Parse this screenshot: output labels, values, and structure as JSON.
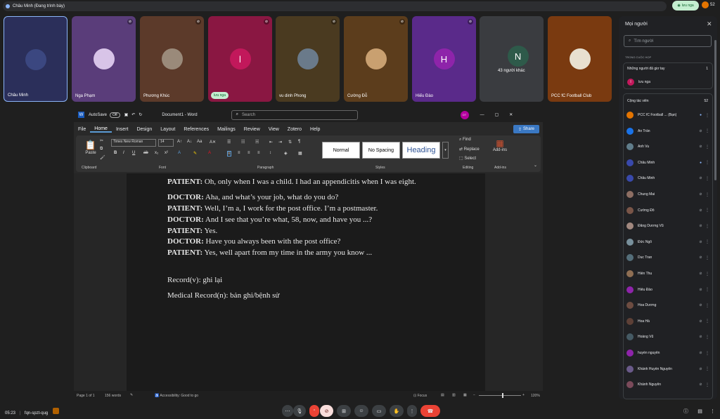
{
  "topbar": {
    "presenter_text": "Châu Minh (Đang trình bày)",
    "present_pill": "lưu nga",
    "people_count": "52"
  },
  "tiles": [
    {
      "name": "Châu Minh",
      "color": "#2b2f5a",
      "avatar": "",
      "muted": false
    },
    {
      "name": "Nga Phạm",
      "color": "#5a3d7a",
      "avatar": "",
      "muted": true
    },
    {
      "name": "Phương Khúc",
      "color": "#5c3a2a",
      "avatar": "",
      "muted": true
    },
    {
      "name": "lưu nga",
      "color": "#8a1742",
      "avatar": "l",
      "muted": true,
      "pill": true
    },
    {
      "name": "vu dinh Phong",
      "color": "#4a3a20",
      "avatar": "",
      "muted": true
    },
    {
      "name": "Cường Đỗ",
      "color": "#5c3d1c",
      "avatar": "",
      "muted": true
    },
    {
      "name": "Hiếu Đào",
      "color": "#5a2a8a",
      "avatar": "H",
      "muted": true
    },
    {
      "name": "43 người khác",
      "color": "#3a3c40",
      "avatar": "N",
      "muted": false,
      "others": true
    },
    {
      "name": "PCC fC Football Club",
      "color": "#7a3a10",
      "avatar": "",
      "muted": false
    }
  ],
  "word": {
    "autosave": "AutoSave",
    "autosave_state": "Off",
    "doc_title": "Document1 - Word",
    "search_placeholder": "Search",
    "user_initials": "DT",
    "menu": [
      "File",
      "Home",
      "Insert",
      "Design",
      "Layout",
      "References",
      "Mailings",
      "Review",
      "View",
      "Zotero",
      "Help"
    ],
    "share": "Share",
    "font_name": "Times New Roman",
    "font_size": "14",
    "styles": [
      "Normal",
      "No Spacing",
      "Heading"
    ],
    "editing": [
      "Find",
      "Replace",
      "Select"
    ],
    "addins": "Add-ins",
    "groups": [
      "Clipboard",
      "Font",
      "Paragraph",
      "Styles",
      "Editing",
      "Add-ins"
    ],
    "paste": "Paste",
    "lines": [
      {
        "speaker": "PATIENT:",
        "text": " Oh, only when I was a child. I had an appendicitis when I was eight."
      },
      {
        "speaker": "DOCTOR:",
        "text": " Aha, and what’s your job, what do you do?"
      },
      {
        "speaker": "PATIENT:",
        "text": " Well, I’m a, I work for the post office. I’m a postmaster."
      },
      {
        "speaker": "DOCTOR:",
        "text": " And I see that you’re what, 58, now, and have you ...?"
      },
      {
        "speaker": "PATIENT:",
        "text": " Yes."
      },
      {
        "speaker": "DOCTOR:",
        "text": " Have you always been with the post office?"
      },
      {
        "speaker": "PATIENT:",
        "text": " Yes, well apart from my time in the army you know ..."
      }
    ],
    "notes": [
      "Record(v): ghi lại",
      "Medical Record(n): bản ghi/bệnh sử"
    ],
    "status": {
      "page": "Page 1 of 1",
      "words": "156 words",
      "accessibility": "Accessibility: Good to go",
      "focus": "Focus",
      "zoom": "120%"
    }
  },
  "panel": {
    "title": "Mọi người",
    "search_placeholder": "Tìm người",
    "in_meeting": "TRONG CUỘC HỌP",
    "raised_hands": "Những người đã giơ tay",
    "raised_count": "1",
    "raised_person": "lưu nga",
    "contributors": "Cộng tác viên",
    "contributors_count": "52",
    "people": [
      {
        "name": "PCC fC Football ... (Bạn)",
        "color": "#e37400"
      },
      {
        "name": "An Trần",
        "color": "#1a73e8"
      },
      {
        "name": "Anh Vu",
        "color": "#607d8b"
      },
      {
        "name": "Châu Minh",
        "color": "#3949ab"
      },
      {
        "name": "Châu Minh",
        "sub": "Bản trình bày",
        "color": "#3949ab"
      },
      {
        "name": "Chung Mai",
        "color": "#8d6e63"
      },
      {
        "name": "Cường Đỗ",
        "color": "#795548"
      },
      {
        "name": "Đăng Dương Vũ",
        "color": "#a1887f"
      },
      {
        "name": "Đức Ngô",
        "color": "#78909c"
      },
      {
        "name": "Duc Tran",
        "color": "#546e7a"
      },
      {
        "name": "Hiền Thu",
        "color": "#8e6e53"
      },
      {
        "name": "Hiếu Đào",
        "color": "#8e24aa"
      },
      {
        "name": "Hoa Dương",
        "color": "#6d4c41"
      },
      {
        "name": "Hoa Hà",
        "color": "#5d4037"
      },
      {
        "name": "Hoàng Vũ",
        "color": "#455a64"
      },
      {
        "name": "huyền nguyễn",
        "color": "#8e24aa"
      },
      {
        "name": "Khánh Huyền Nguyễn",
        "color": "#6a5a8a"
      },
      {
        "name": "Khánh Nguyễn",
        "color": "#7a4a5a"
      }
    ]
  },
  "bottom": {
    "time": "05:23",
    "meeting_code": "fqn-spzt-qug"
  }
}
